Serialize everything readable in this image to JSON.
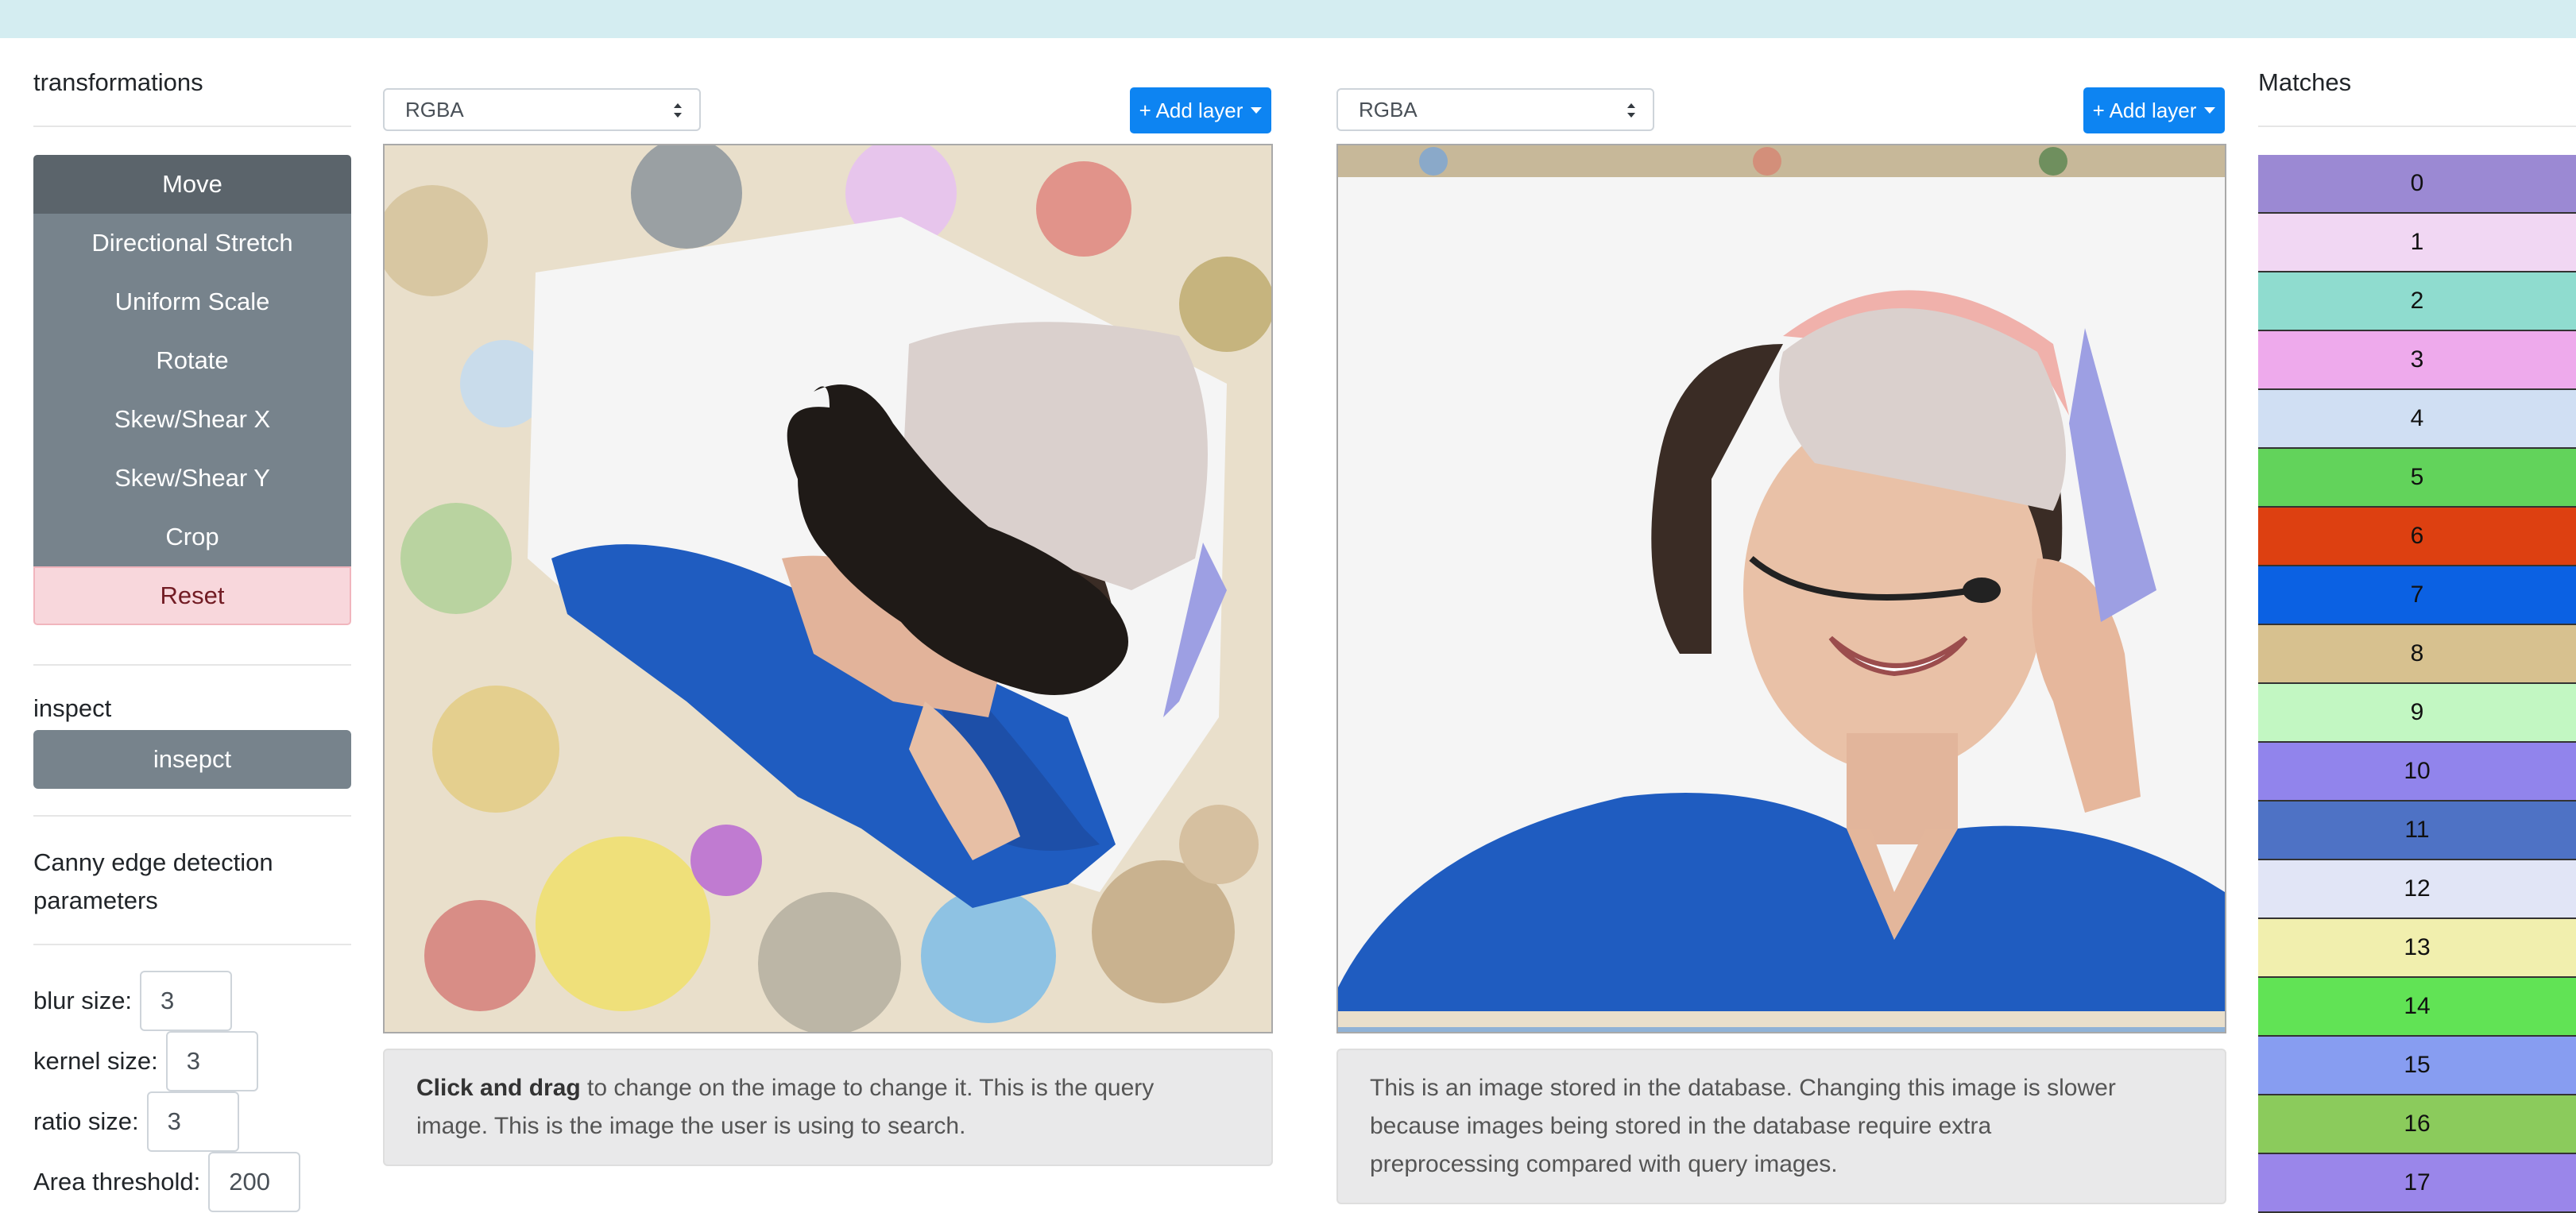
{
  "transformations": {
    "title": "transformations",
    "buttons": [
      "Move",
      "Directional Stretch",
      "Uniform Scale",
      "Rotate",
      "Skew/Shear X",
      "Skew/Shear Y",
      "Crop"
    ],
    "reset_label": "Reset"
  },
  "inspect": {
    "title": "inspect",
    "button_label": "insepct"
  },
  "canny": {
    "title_line1": "Canny edge detection",
    "title_line2": "parameters",
    "params": [
      {
        "label": "blur size:",
        "value": "3"
      },
      {
        "label": "kernel size:",
        "value": "3"
      },
      {
        "label": "ratio size:",
        "value": "3"
      },
      {
        "label": "Area threshold:",
        "value": "200"
      }
    ]
  },
  "query_panel": {
    "mode": "RGBA",
    "add_layer_label": "+ Add layer",
    "note_bold": "Click and drag",
    "note_line1_rest": " to change on the image to change it. This is the query",
    "note_line2": "image. This is the image the user is using to search."
  },
  "db_panel": {
    "mode": "RGBA",
    "add_layer_label": "+ Add layer",
    "note_line1": "This is an image stored in the database. Changing this image is slower",
    "note_line2": "because images being stored in the database require extra",
    "note_line3": "preprocessing compared with query images."
  },
  "matches": {
    "title": "Matches",
    "items": [
      {
        "label": "0",
        "color": "#9b89d3"
      },
      {
        "label": "1",
        "color": "#f1d7f3"
      },
      {
        "label": "2",
        "color": "#8fdccf"
      },
      {
        "label": "3",
        "color": "#eeaaec"
      },
      {
        "label": "4",
        "color": "#d0dff3"
      },
      {
        "label": "5",
        "color": "#62d35b"
      },
      {
        "label": "6",
        "color": "#dd4011"
      },
      {
        "label": "7",
        "color": "#0b61e3"
      },
      {
        "label": "8",
        "color": "#d7c18f"
      },
      {
        "label": "9",
        "color": "#c2f7c2"
      },
      {
        "label": "10",
        "color": "#9184ec"
      },
      {
        "label": "11",
        "color": "#4e72c5"
      },
      {
        "label": "12",
        "color": "#e1e5f6"
      },
      {
        "label": "13",
        "color": "#f1efae"
      },
      {
        "label": "14",
        "color": "#61e355"
      },
      {
        "label": "15",
        "color": "#879df1"
      },
      {
        "label": "16",
        "color": "#8bcb5c"
      },
      {
        "label": "17",
        "color": "#9a86ea"
      }
    ]
  }
}
